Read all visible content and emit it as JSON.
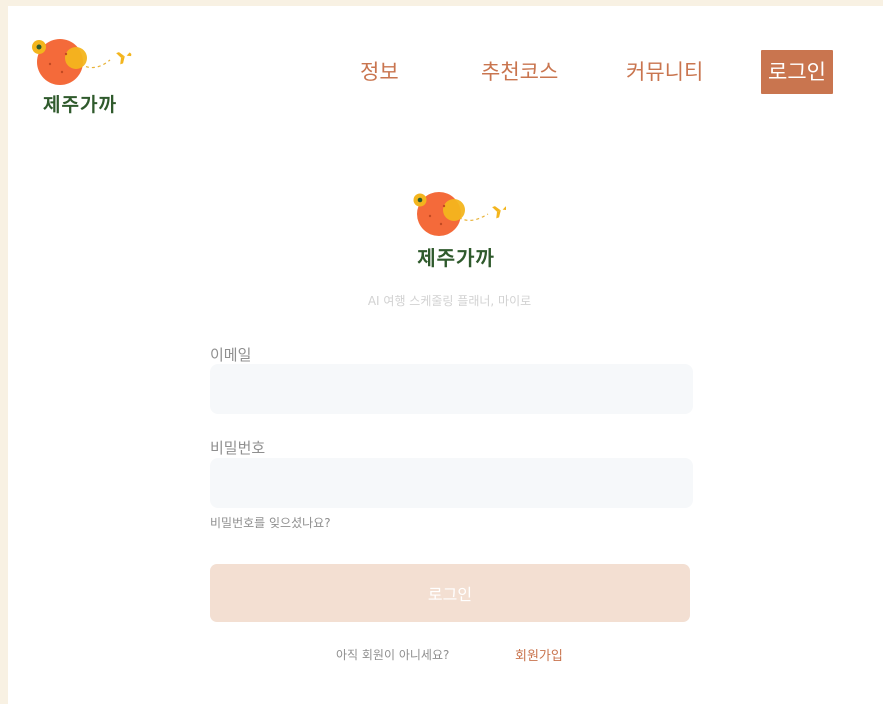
{
  "brand": {
    "name": "제주가까",
    "tagline": "AI 여행 스케줄링 플래너, 마이로"
  },
  "nav": {
    "items": [
      "정보",
      "추천코스",
      "커뮤니티"
    ],
    "login": "로그인"
  },
  "form": {
    "email_label": "이메일",
    "email_value": "",
    "password_label": "비밀번호",
    "password_value": "",
    "forgot_link": "비밀번호를 잊으셨나요?",
    "login_button": "로그인",
    "signup_question": "아직 회원이 아니세요?",
    "signup_link": "회원가입"
  },
  "colors": {
    "accent": "#c9754f",
    "logo_fruit": "#f46a3a",
    "logo_highlight": "#f3b51d",
    "logo_text": "#2f5a2c",
    "button_disabled": "#f3dfd2",
    "input_bg": "#f6f8fa"
  },
  "icons": [
    "tangerine-logo-icon",
    "airplane-icon"
  ]
}
